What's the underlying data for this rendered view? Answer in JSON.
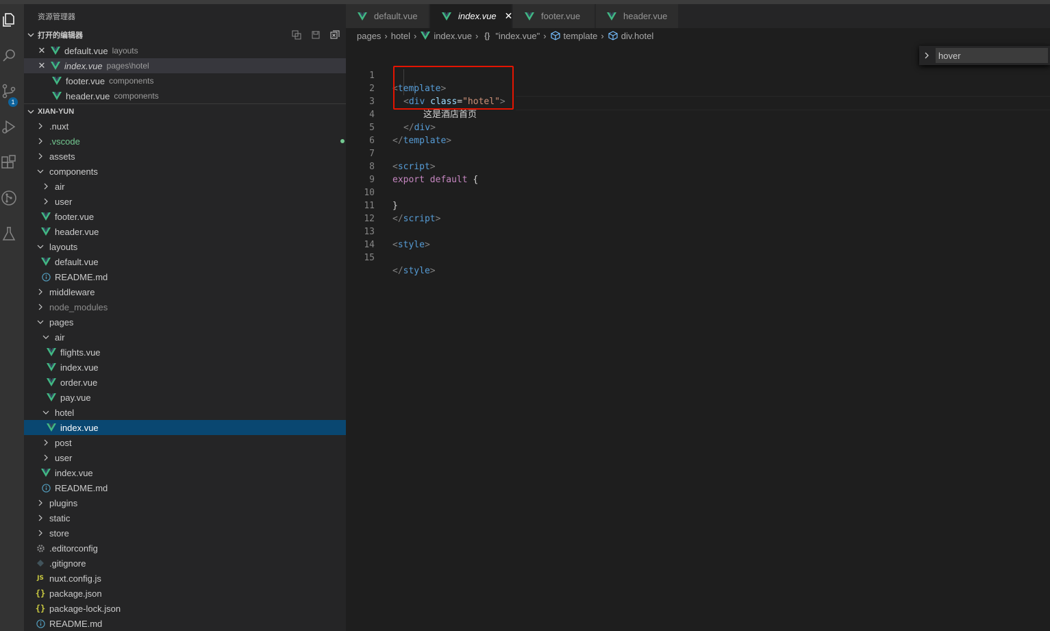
{
  "explorer": {
    "title": "资源管理器",
    "open_editors": {
      "header": "打开的编辑器",
      "items": [
        {
          "name": "default.vue",
          "desc": "layouts"
        },
        {
          "name": "index.vue",
          "desc": "pages\\hotel"
        },
        {
          "name": "footer.vue",
          "desc": "components"
        },
        {
          "name": "header.vue",
          "desc": "components"
        }
      ]
    },
    "project": {
      "header": "XIAN-YUN",
      "tree": [
        {
          "label": ".nuxt"
        },
        {
          "label": ".vscode"
        },
        {
          "label": "assets"
        },
        {
          "label": "components"
        },
        {
          "label": "air"
        },
        {
          "label": "user"
        },
        {
          "label": "footer.vue"
        },
        {
          "label": "header.vue"
        },
        {
          "label": "layouts"
        },
        {
          "label": "default.vue"
        },
        {
          "label": "README.md"
        },
        {
          "label": "middleware"
        },
        {
          "label": "node_modules"
        },
        {
          "label": "pages"
        },
        {
          "label": "air"
        },
        {
          "label": "flights.vue"
        },
        {
          "label": "index.vue"
        },
        {
          "label": "order.vue"
        },
        {
          "label": "pay.vue"
        },
        {
          "label": "hotel"
        },
        {
          "label": "index.vue"
        },
        {
          "label": "post"
        },
        {
          "label": "user"
        },
        {
          "label": "index.vue"
        },
        {
          "label": "README.md"
        },
        {
          "label": "plugins"
        },
        {
          "label": "static"
        },
        {
          "label": "store"
        },
        {
          "label": ".editorconfig"
        },
        {
          "label": ".gitignore"
        },
        {
          "label": "nuxt.config.js"
        },
        {
          "label": "package.json"
        },
        {
          "label": "package-lock.json"
        },
        {
          "label": "README.md"
        }
      ]
    }
  },
  "activity_bar": {
    "icons": [
      "files-icon",
      "search-icon",
      "source-control-icon",
      "run-debug-icon",
      "extensions-icon",
      "git-graph-icon",
      "testing-icon"
    ],
    "scm_badge": "1"
  },
  "tabs": [
    {
      "label": "default.vue"
    },
    {
      "label": "index.vue",
      "close": "✕"
    },
    {
      "label": "footer.vue"
    },
    {
      "label": "header.vue"
    }
  ],
  "breadcrumb": {
    "items": [
      "pages",
      "hotel",
      "index.vue",
      "\"index.vue\"",
      "template",
      "div.hotel"
    ]
  },
  "editor": {
    "line_numbers": [
      "1",
      "2",
      "3",
      "4",
      "5",
      "6",
      "7",
      "8",
      "9",
      "10",
      "11",
      "12",
      "13",
      "14",
      "15"
    ],
    "code": {
      "l1_open": "<",
      "l1_tag": "template",
      "l1_close": ">",
      "l2_open": "<",
      "l2_tag": "div",
      "l2_attr": "class",
      "l2_eq": "=",
      "l2_val": "\"hotel\"",
      "l2_close": ">",
      "l3_text": "这是酒店首页",
      "l4_open": "</",
      "l4_tag": "div",
      "l4_close": ">",
      "l5_open": "</",
      "l5_tag": "template",
      "l5_close": ">",
      "l7_open": "<",
      "l7_tag": "script",
      "l7_close": ">",
      "l8_kw": "export",
      "l8_kw2": "default",
      "l8_brace": "{",
      "l10_brace": "}",
      "l11_open": "</",
      "l11_tag": "script",
      "l11_close": ">",
      "l13_open": "<",
      "l13_tag": "style",
      "l13_close": ">",
      "l15_open": "</",
      "l15_tag": "style",
      "l15_close": ">"
    }
  },
  "find_widget": {
    "value": "hover"
  },
  "colors": {
    "accent": "#094771",
    "vue": "#41b883",
    "highlight_box": "#e51400"
  }
}
